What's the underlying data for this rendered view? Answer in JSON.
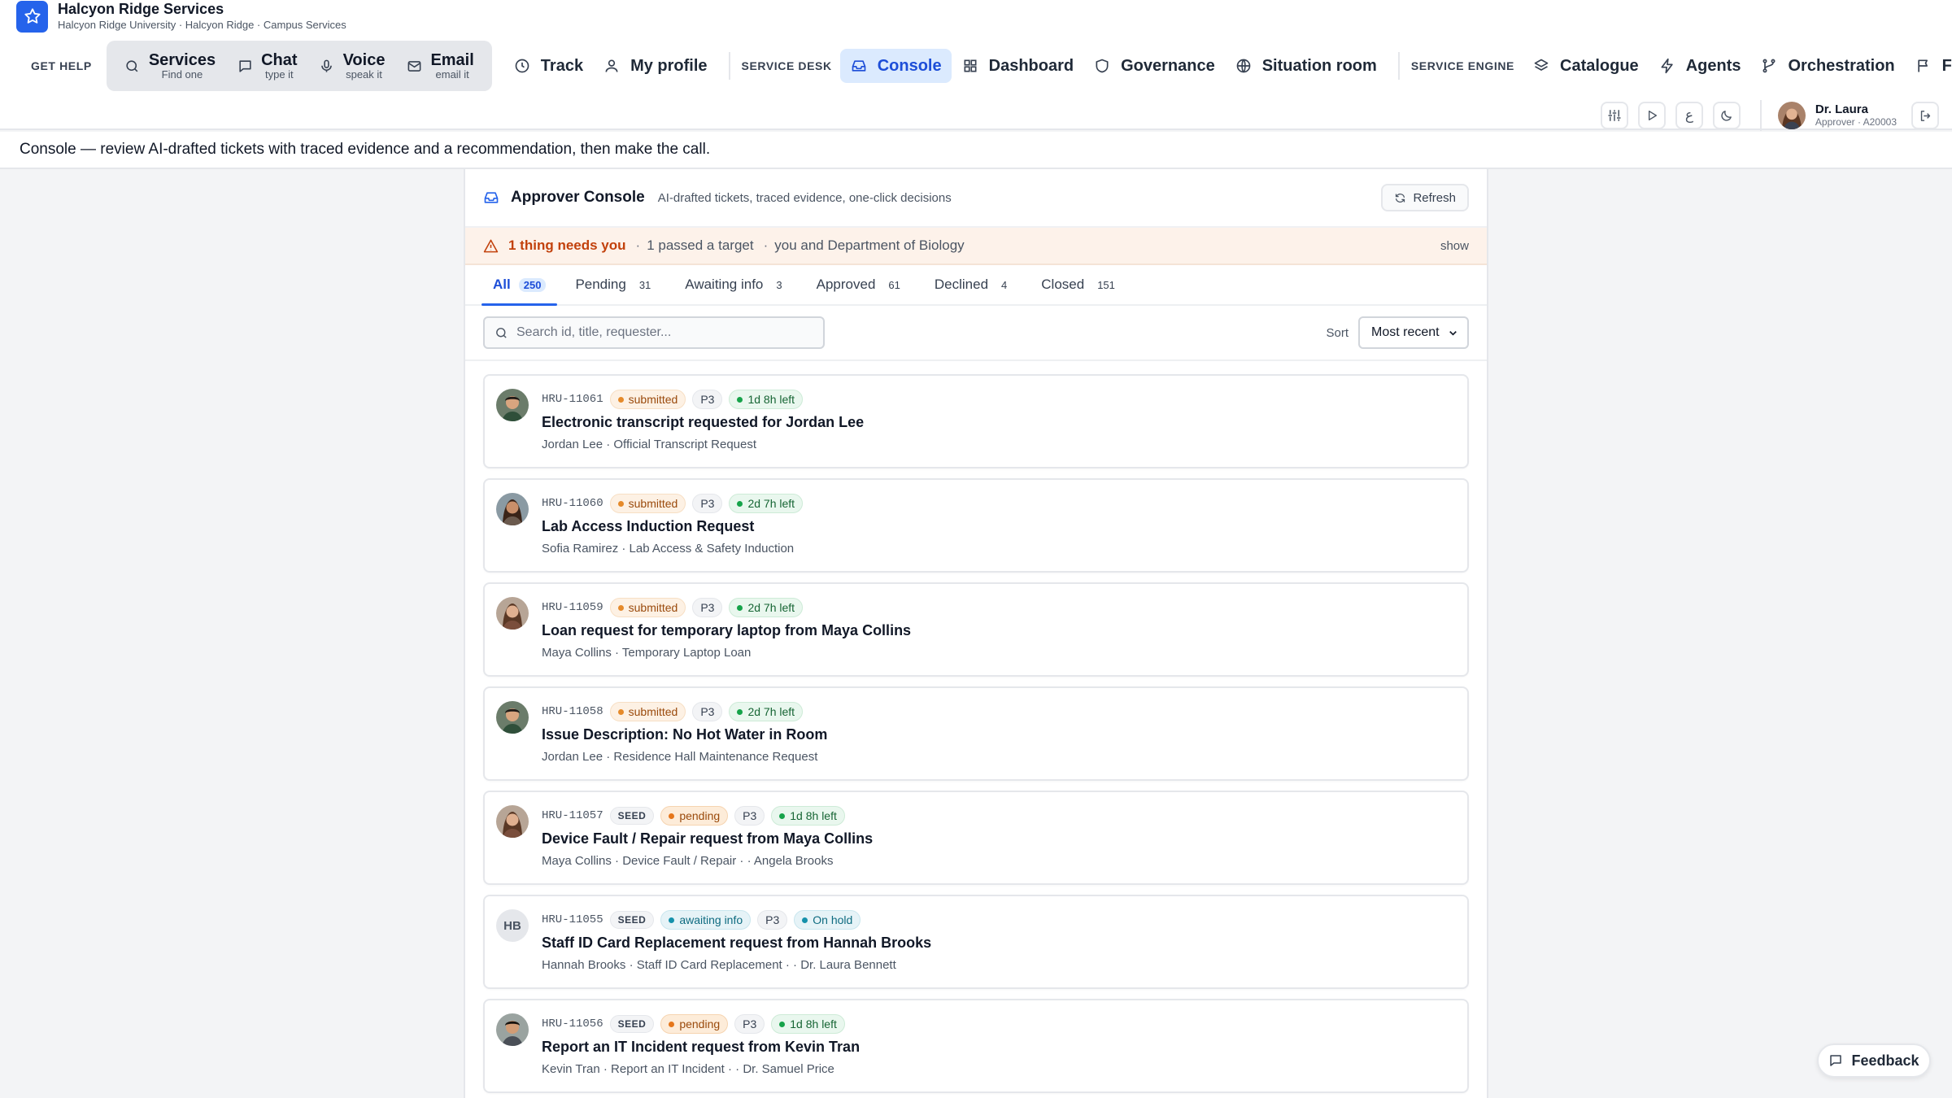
{
  "brand": {
    "title": "Halcyon Ridge Services",
    "subtitle": "Halcyon Ridge University · Halcyon Ridge · Campus Services",
    "icon": "star-icon"
  },
  "nav": {
    "get_help_label": "GET HELP",
    "channels": [
      {
        "title": "Services",
        "sub": "Find one",
        "icon": "search-icon"
      },
      {
        "title": "Chat",
        "sub": "type it",
        "icon": "chat-icon"
      },
      {
        "title": "Voice",
        "sub": "speak it",
        "icon": "microphone-icon"
      },
      {
        "title": "Email",
        "sub": "email it",
        "icon": "mail-icon"
      }
    ],
    "track_label": "Track",
    "profile_label": "My profile",
    "service_desk_label": "SERVICE DESK",
    "desk_items": [
      {
        "label": "Console",
        "icon": "inbox-icon",
        "active": true
      },
      {
        "label": "Dashboard",
        "icon": "grid-icon"
      },
      {
        "label": "Governance",
        "icon": "shield-icon"
      },
      {
        "label": "Situation room",
        "icon": "globe-icon"
      }
    ],
    "service_engine_label": "SERVICE ENGINE",
    "engine_items": [
      {
        "label": "Catalogue",
        "icon": "layers-icon"
      },
      {
        "label": "Agents",
        "icon": "bolt-icon"
      },
      {
        "label": "Orchestration",
        "icon": "branch-icon"
      },
      {
        "label": "F",
        "icon": "flag-icon"
      }
    ]
  },
  "user": {
    "name": "Dr. Laura",
    "role": "Approver · A20003"
  },
  "caption": "Console — review AI-drafted tickets with traced evidence and a recommendation, then make the call.",
  "panel": {
    "title": "Approver Console",
    "subtitle": "AI-drafted tickets, traced evidence, one-click decisions",
    "refresh_label": "Refresh"
  },
  "alert": {
    "main": "1 thing needs you",
    "part2": "1 passed a target",
    "part3": "you and Department of Biology",
    "show_label": "show"
  },
  "tabs": [
    {
      "label": "All",
      "count": "250",
      "active": true
    },
    {
      "label": "Pending",
      "count": "31"
    },
    {
      "label": "Awaiting info",
      "count": "3"
    },
    {
      "label": "Approved",
      "count": "61"
    },
    {
      "label": "Declined",
      "count": "4"
    },
    {
      "label": "Closed",
      "count": "151"
    }
  ],
  "search": {
    "placeholder": "Search id, title, requester..."
  },
  "sort": {
    "label": "Sort",
    "value": "Most recent"
  },
  "tickets": [
    {
      "id": "HRU-11061",
      "seed": "",
      "status": "submitted",
      "priority": "P3",
      "sla": "1d 8h left",
      "title": "Electronic transcript requested for Jordan Lee",
      "sub": "Jordan Lee · Official Transcript Request",
      "avatar": "photo-jordan"
    },
    {
      "id": "HRU-11060",
      "seed": "",
      "status": "submitted",
      "priority": "P3",
      "sla": "2d 7h left",
      "title": "Lab Access Induction Request",
      "sub": "Sofia Ramirez · Lab Access & Safety Induction",
      "avatar": "photo-sofia"
    },
    {
      "id": "HRU-11059",
      "seed": "",
      "status": "submitted",
      "priority": "P3",
      "sla": "2d 7h left",
      "title": "Loan request for temporary laptop from Maya Collins",
      "sub": "Maya Collins · Temporary Laptop Loan",
      "avatar": "photo-maya"
    },
    {
      "id": "HRU-11058",
      "seed": "",
      "status": "submitted",
      "priority": "P3",
      "sla": "2d 7h left",
      "title": "Issue Description: No Hot Water in Room",
      "sub": "Jordan Lee · Residence Hall Maintenance Request",
      "avatar": "photo-jordan"
    },
    {
      "id": "HRU-11057",
      "seed": "SEED",
      "status": "pending",
      "priority": "P3",
      "sla": "1d 8h left",
      "title": "Device Fault / Repair request from Maya Collins",
      "sub": "Maya Collins · Device Fault / Repair · · Angela Brooks",
      "avatar": "photo-maya"
    },
    {
      "id": "HRU-11055",
      "seed": "SEED",
      "status": "awaiting info",
      "priority": "P3",
      "sla": "On hold",
      "title": "Staff ID Card Replacement request from Hannah Brooks",
      "sub": "Hannah Brooks · Staff ID Card Replacement · · Dr. Laura Bennett",
      "avatar": "initials",
      "initials": "HB"
    },
    {
      "id": "HRU-11056",
      "seed": "SEED",
      "status": "pending",
      "priority": "P3",
      "sla": "1d 8h left",
      "title": "Report an IT Incident request from Kevin Tran",
      "sub": "Kevin Tran · Report an IT Incident · · Dr. Samuel Price",
      "avatar": "photo-kevin"
    }
  ],
  "feedback_label": "Feedback"
}
